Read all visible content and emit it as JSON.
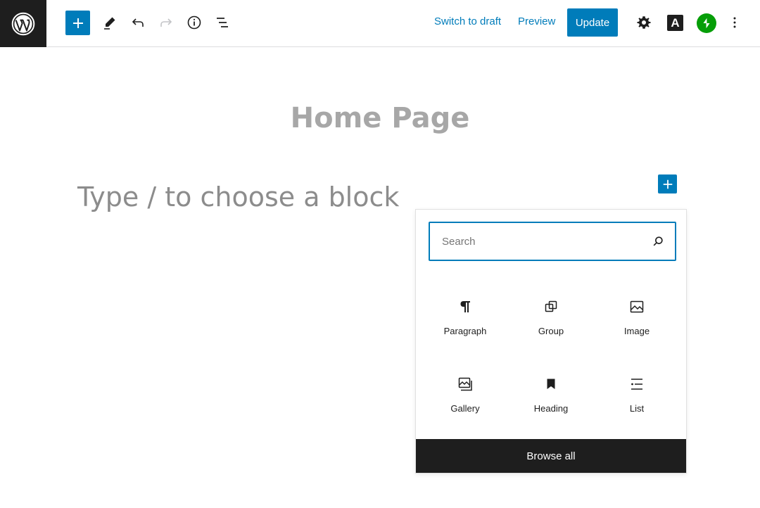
{
  "toolbar": {
    "switch_to_draft": "Switch to draft",
    "preview": "Preview",
    "update": "Update",
    "astra_letter": "A",
    "icons": [
      "wordpress-logo",
      "add-block",
      "edit-pencil",
      "undo",
      "redo",
      "details-info",
      "list-view",
      "settings-gear",
      "astra",
      "jetpack",
      "more-options"
    ]
  },
  "editor": {
    "page_title": "Home Page",
    "block_placeholder": "Type / to choose a block"
  },
  "inserter": {
    "search_placeholder": "Search",
    "blocks": [
      {
        "label": "Paragraph",
        "icon": "paragraph"
      },
      {
        "label": "Group",
        "icon": "group"
      },
      {
        "label": "Image",
        "icon": "image"
      },
      {
        "label": "Gallery",
        "icon": "gallery"
      },
      {
        "label": "Heading",
        "icon": "heading-bookmark"
      },
      {
        "label": "List",
        "icon": "list"
      }
    ],
    "browse_all": "Browse all"
  },
  "colors": {
    "accent": "#007cba",
    "dark": "#1e1e1e",
    "jetpack": "#069e08"
  }
}
